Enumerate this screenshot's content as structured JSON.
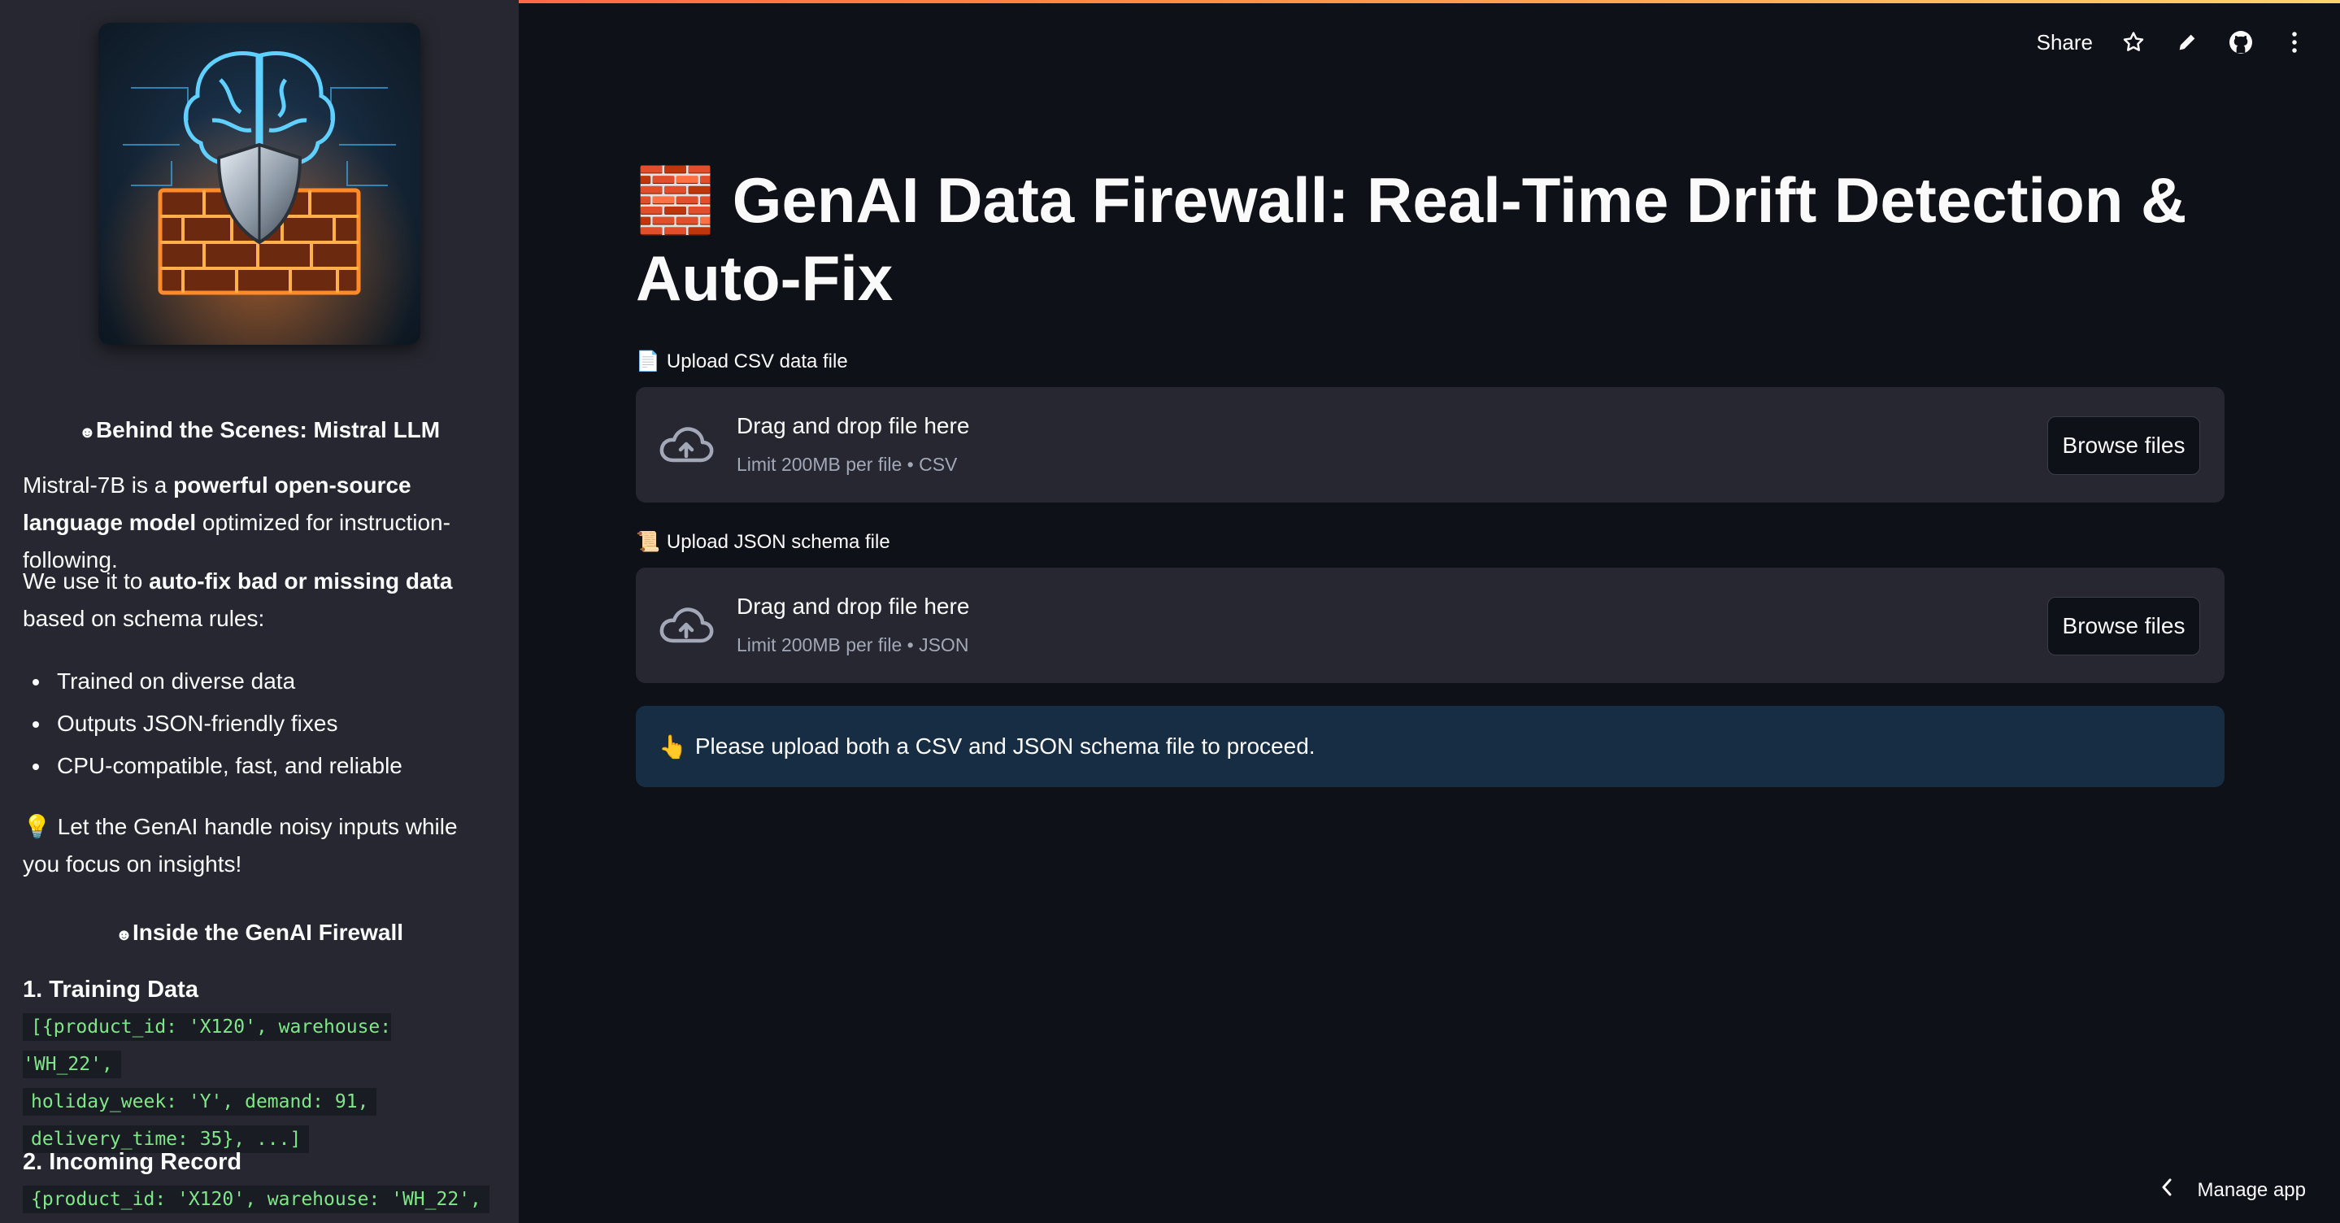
{
  "sidebar": {
    "section1_heading": "Behind the Scenes: Mistral LLM",
    "para1_pre": "Mistral-7B is a ",
    "para1_bold": "powerful open-source language model",
    "para1_post": " optimized for instruction-following.",
    "para2_pre": "We use it to ",
    "para2_bold": "auto-fix bad or missing data",
    "para2_post": " based on schema rules:",
    "bullets": [
      "Trained on diverse data",
      "Outputs JSON-friendly fixes",
      "CPU-compatible, fast, and reliable"
    ],
    "tip_emoji": "💡",
    "tip_text": " Let the GenAI handle noisy inputs while you focus on insights!",
    "section2_heading": "Inside the GenAI Firewall",
    "step1_title": "1. Training Data",
    "step1_code_line1": "[{product_id: 'X120', warehouse: 'WH_22',",
    "step1_code_line2": "holiday_week: 'Y', demand: 91,",
    "step1_code_line3": "delivery_time: 35}, ...]",
    "step2_title": "2. Incoming Record",
    "step2_code_line1": "{product_id: 'X120', warehouse: 'WH_22',"
  },
  "toolbar": {
    "share_label": "Share"
  },
  "main": {
    "title_emoji": "🧱",
    "title": "GenAI Data Firewall: Real-Time Drift Detection & Auto-Fix",
    "csv_label_emoji": "📄",
    "csv_label": "Upload CSV data file",
    "csv_drop_text": "Drag and drop file here",
    "csv_limit": "Limit 200MB per file • CSV",
    "csv_browse": "Browse files",
    "json_label_emoji": "📜",
    "json_label": "Upload JSON schema file",
    "json_drop_text": "Drag and drop file here",
    "json_limit": "Limit 200MB per file • JSON",
    "json_browse": "Browse files",
    "info_emoji": "👆",
    "info_text": "Please upload both a CSV and JSON schema file to proceed.",
    "manage_app": "Manage app"
  },
  "colors": {
    "background": "#0e1117",
    "sidebar": "#262730",
    "dropzone": "#262730",
    "info": "#172d43",
    "code_text": "#7ee787",
    "accent_gradient_start": "#ff4b4b",
    "accent_gradient_end": "#ffd36b"
  }
}
